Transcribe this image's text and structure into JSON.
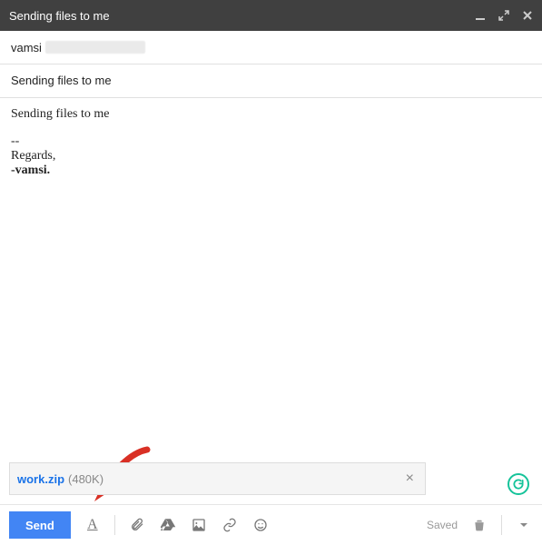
{
  "header": {
    "title": "Sending files to me"
  },
  "fields": {
    "to_visible": "vamsi",
    "subject": "Sending files to me"
  },
  "body": {
    "text": "Sending files to me",
    "sig_dashes": "--",
    "sig_regards": "Regards,",
    "sig_name": "-vamsi."
  },
  "attachment": {
    "name": "work.zip",
    "size": "(480K)"
  },
  "toolbar": {
    "send": "Send",
    "saved": "Saved"
  }
}
